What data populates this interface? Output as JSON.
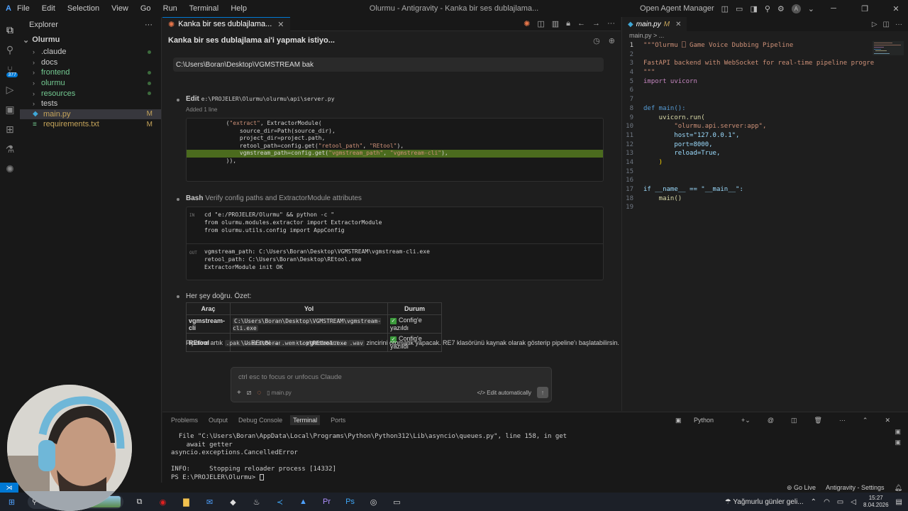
{
  "window": {
    "title": "Olurmu - Antigravity - Kanka bir ses dublajlama...",
    "menu": [
      "File",
      "Edit",
      "Selection",
      "View",
      "Go",
      "Run",
      "Terminal",
      "Help"
    ],
    "agent_manager": "Open Agent Manager",
    "account_initial": "A"
  },
  "activity": {
    "badge": "377"
  },
  "explorer": {
    "header": "Explorer",
    "root": "Olurmu",
    "items": [
      {
        "label": ".claude",
        "type": "folder",
        "status": "dot"
      },
      {
        "label": "docs",
        "type": "folder",
        "status": ""
      },
      {
        "label": "frontend",
        "type": "folder",
        "status": "dot"
      },
      {
        "label": "olurmu",
        "type": "folder",
        "status": "dot"
      },
      {
        "label": "resources",
        "type": "folder",
        "status": "dot"
      },
      {
        "label": "tests",
        "type": "folder",
        "status": ""
      },
      {
        "label": "main.py",
        "type": "python",
        "status": "M"
      },
      {
        "label": "requirements.txt",
        "type": "text",
        "status": "M"
      }
    ]
  },
  "chat": {
    "tab_label": "Kanka bir ses dublajlama...",
    "heading": "Kanka bir ses dublajlama ai'i yapmak istiyo...",
    "path_box": "C:\\Users\\Boran\\Desktop\\VGMSTREAM bak",
    "edit_step": {
      "kind": "Edit",
      "path": "e:\\PROJELER\\Olurmu\\olurmu\\api\\server.py",
      "added": "Added 1 line"
    },
    "bash_step": {
      "kind": "Bash",
      "desc": "Verify config paths and ExtractorModule attributes",
      "in_label": "IN",
      "out_label": "OUT",
      "in_lines": [
        "cd \"e:/PROJELER/Olurmu\" && python -c \"",
        "from olurmu.modules.extractor import ExtractorModule",
        "from olurmu.utils.config import AppConfig"
      ],
      "out_lines": [
        "vgmstream_path: C:\\Users\\Boran\\Desktop\\VGMSTREAM\\vgmstream-cli.exe",
        "retool_path: C:\\Users\\Boran\\Desktop\\REtool.exe",
        "ExtractorModule init OK"
      ]
    },
    "summary_intro": "Her şey doğru. Özet:",
    "table": {
      "headers": [
        "Araç",
        "Yol",
        "Durum"
      ],
      "rows": [
        {
          "tool": "vgmstream-cli",
          "path": "C:\\Users\\Boran\\Desktop\\VGMSTREAM\\vgmstream-cli.exe",
          "status": "Config'e yazıldı"
        },
        {
          "tool": "REtool",
          "path": "C:\\Users\\Boran\\Desktop\\REtool.exe",
          "status": "Config'e yazıldı"
        }
      ]
    },
    "pipeline": {
      "prefix": "Pipeline artık",
      "pak": ".pak",
      "arrow1": "→ REtool →",
      "wem": ".wem",
      "arrow2": "→ vgmstream →",
      "wav": ".wav",
      "suffix": "zincirini otomatik yapacak. RE7 klasörünü kaynak olarak gösterip pipeline'ı başlatabilirsin."
    },
    "input": {
      "placeholder": "ctrl esc to focus or unfocus Claude",
      "file": "main.py",
      "mode": "Edit automatically"
    }
  },
  "editor": {
    "tab": "main.py",
    "tab_status": "M",
    "breadcrumb": "main.py > ...",
    "lines": [
      {
        "n": "1",
        "text": "\"\"\"Olurmu ⎕ Game Voice Dubbing Pipeline"
      },
      {
        "n": "2",
        "text": ""
      },
      {
        "n": "3",
        "text": "FastAPI backend with WebSocket for real-time pipeline progre"
      },
      {
        "n": "4",
        "text": "\"\"\""
      },
      {
        "n": "5",
        "text": "import uvicorn"
      },
      {
        "n": "6",
        "text": ""
      },
      {
        "n": "7",
        "text": ""
      },
      {
        "n": "8",
        "text": "def main():"
      },
      {
        "n": "9",
        "text": "    uvicorn.run("
      },
      {
        "n": "10",
        "text": "        \"olurmu.api.server:app\","
      },
      {
        "n": "11",
        "text": "        host=\"127.0.0.1\","
      },
      {
        "n": "12",
        "text": "        port=8000,"
      },
      {
        "n": "13",
        "text": "        reload=True,"
      },
      {
        "n": "14",
        "text": "    )"
      },
      {
        "n": "15",
        "text": ""
      },
      {
        "n": "16",
        "text": ""
      },
      {
        "n": "17",
        "text": "if __name__ == \"__main__\":"
      },
      {
        "n": "18",
        "text": "    main()"
      },
      {
        "n": "19",
        "text": ""
      }
    ]
  },
  "panel": {
    "tabs": [
      "Problems",
      "Output",
      "Debug Console",
      "Terminal",
      "Ports"
    ],
    "active_tab": "Terminal",
    "shell": "Python",
    "lines": [
      "  File \"C:\\Users\\Boran\\AppData\\Local\\Programs\\Python\\Python312\\Lib\\asyncio\\queues.py\", line 158, in get",
      "    await getter",
      "asyncio.exceptions.CancelledError",
      "",
      "INFO:     Stopping reloader process [14332]",
      "PS E:\\PROJELER\\Olurmu> "
    ]
  },
  "statusbar": {
    "go_live": "Go Live",
    "settings": "Antigravity - Settings"
  },
  "taskbar": {
    "weather": "Yağmurlu günler geli...",
    "time": "15:27",
    "date": "8.04.2026"
  }
}
